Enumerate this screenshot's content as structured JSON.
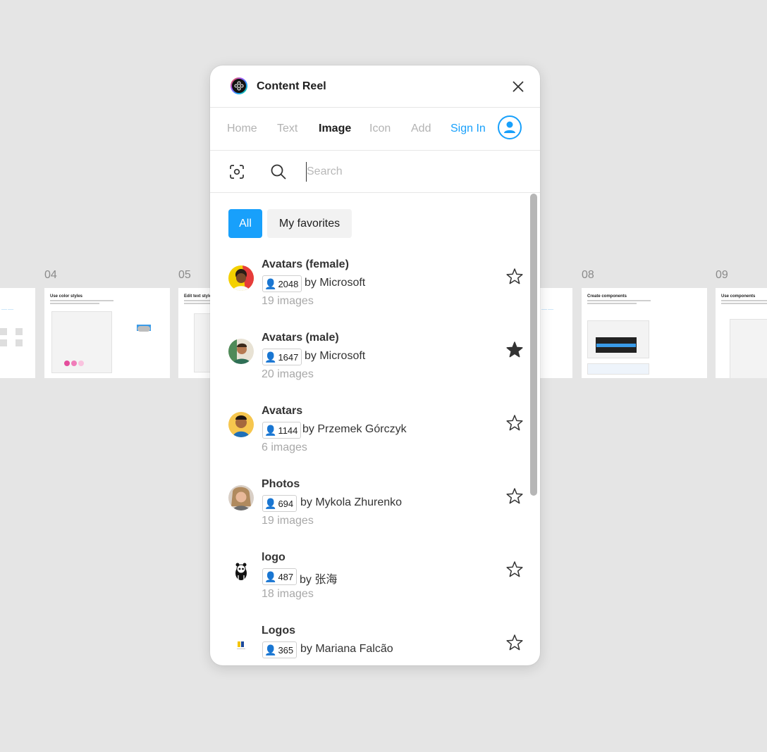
{
  "canvas": {
    "frames": [
      {
        "number": "04",
        "title": "Use color styles"
      },
      {
        "number": "05",
        "title": "Edit text styles"
      },
      {
        "number": "08",
        "title": "Create components"
      },
      {
        "number": "09",
        "title": "Use components"
      }
    ]
  },
  "window": {
    "title": "Content Reel",
    "tabs": [
      {
        "label": "Home"
      },
      {
        "label": "Text"
      },
      {
        "label": "Image"
      },
      {
        "label": "Icon"
      },
      {
        "label": "Add"
      }
    ],
    "active_tab": "Image",
    "sign_in_label": "Sign In",
    "search": {
      "placeholder": "Search",
      "value": ""
    },
    "filters": {
      "all": "All",
      "favorites": "My favorites"
    },
    "items": [
      {
        "title": "Avatars (female)",
        "users": "2048",
        "author": "by Microsoft",
        "count": "19 images",
        "favorited": false
      },
      {
        "title": "Avatars (male)",
        "users": "1647",
        "author": "by Microsoft",
        "count": "20 images",
        "favorited": true
      },
      {
        "title": "Avatars",
        "users": "1144",
        "author": "by Przemek Górczyk",
        "count": "6 images",
        "favorited": false
      },
      {
        "title": "Photos",
        "users": "694",
        "author": "by Mykola Zhurenko",
        "count": "19 images",
        "favorited": false
      },
      {
        "title": "logo",
        "users": "487",
        "author": "by 张海",
        "count": "18 images",
        "favorited": false
      },
      {
        "title": "Logos",
        "users": "365",
        "author": "by Mariana Falcão",
        "count": "",
        "favorited": false
      }
    ]
  },
  "colors": {
    "accent": "#18a0fb",
    "star_filled": "#333333"
  }
}
